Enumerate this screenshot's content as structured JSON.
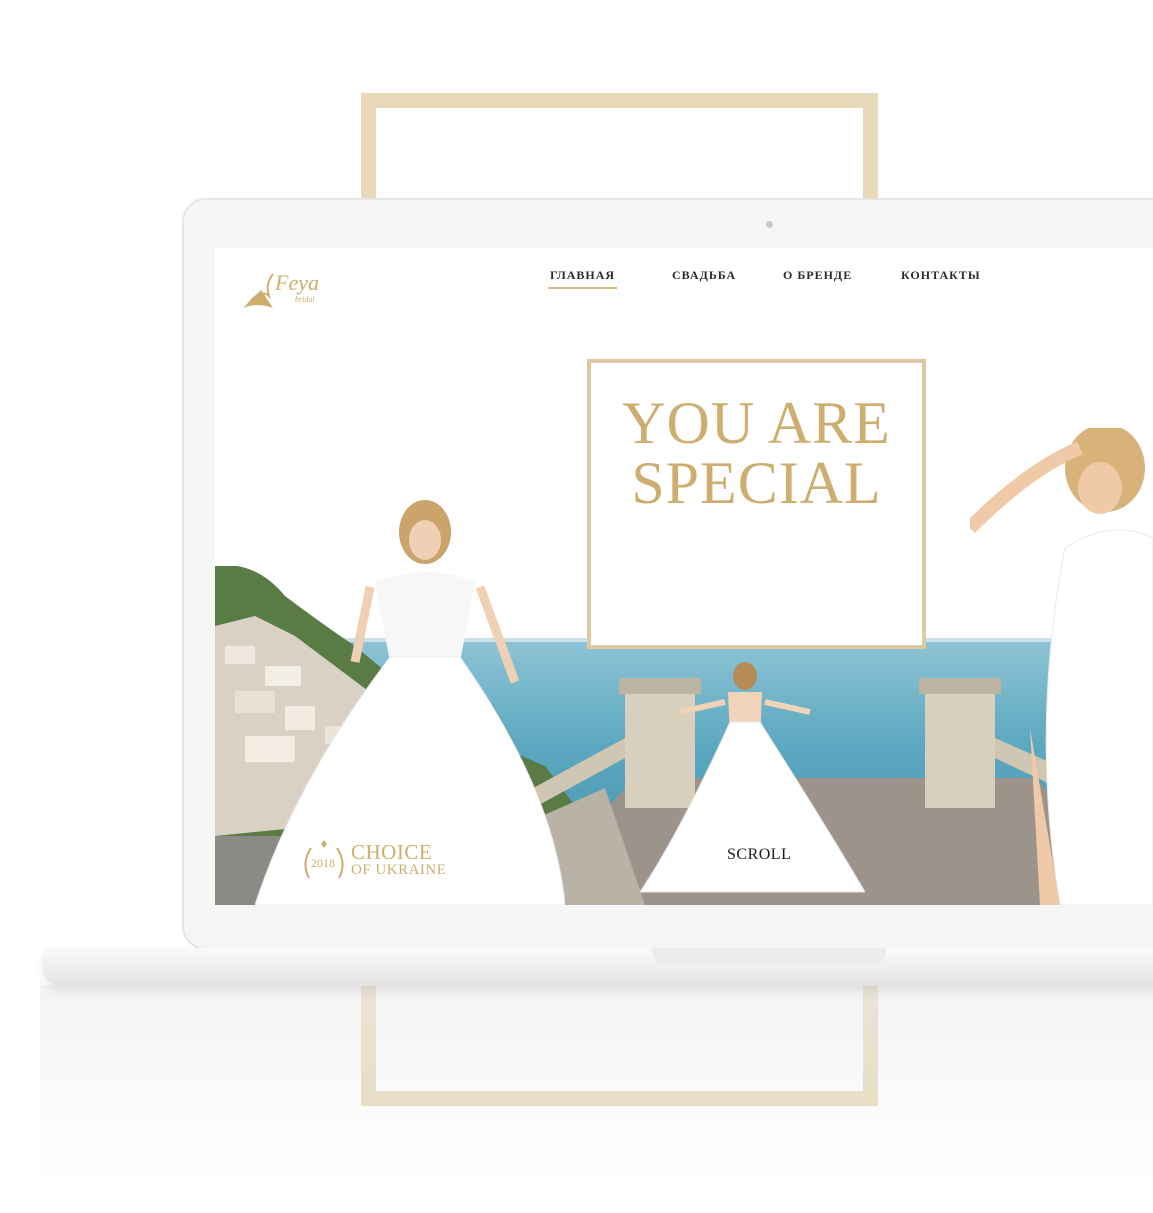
{
  "brand": {
    "logo_text": "Feya",
    "logo_sub": "bridal"
  },
  "nav": {
    "items": [
      {
        "label": "ГЛАВНАЯ",
        "active": true
      },
      {
        "label": "СВАДЬБА",
        "active": false
      },
      {
        "label": "О БРЕНДЕ",
        "active": false
      },
      {
        "label": "КОНТАКТЫ",
        "active": false
      }
    ]
  },
  "hero": {
    "line1": "YOU ARE",
    "line2": "SPECIAL"
  },
  "badge": {
    "year": "2018",
    "line1": "CHOICE",
    "line2": "OF UKRAINE"
  },
  "scroll_label": "SCROLL",
  "colors": {
    "gold": "#cdae6f",
    "frame_gold": "#e8d9b8",
    "sea": "#5da8c0"
  }
}
